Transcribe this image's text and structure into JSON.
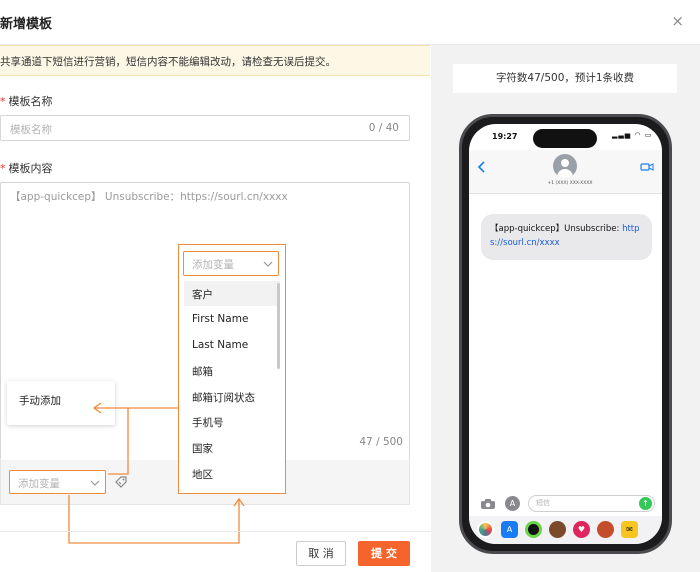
{
  "dialog": {
    "title": "新增模板",
    "close_glyph": "×",
    "notice": "共享通道下短信进行营销，短信内容不能编辑改动，请检查无误后提交。",
    "name_label": "模板名称",
    "name_placeholder": "模板名称",
    "name_counter": "0 / 40",
    "content_label": "模板内容",
    "content_text": "【app-quickcep】 Unsubscribe：https://sourl.cn/xxxx",
    "content_counter": "47 / 500",
    "variable_placeholder": "添加变量",
    "variable_dropdown_placeholder": "添加变量",
    "variable_options": [
      "客户",
      "First Name",
      "Last Name",
      "邮箱",
      "邮箱订阅状态",
      "手机号",
      "国家",
      "地区"
    ],
    "manual_add": "手动添加",
    "cancel_label": "取 消",
    "submit_label": "提 交",
    "required_mark": "*"
  },
  "preview": {
    "char_info": "字符数47/500，预计1条收费",
    "status_time": "19:27",
    "contact_number": "+1 (XXX) XXX-XXXX",
    "message_prefix": "【app-quickcep】Unsubscribe: ",
    "message_link": "https://sourl.cn/xxxx",
    "input_placeholder": "短信"
  },
  "colors": {
    "accent": "#f5642c",
    "highlight": "#f08a3c",
    "link": "#1a5bd6",
    "bubble": "#e9e9eb"
  },
  "icons": {
    "close": "close-icon",
    "dropdown": "chevron-down-icon",
    "tag": "tag-icon",
    "back": "chevron-left-icon",
    "video": "video-icon",
    "camera": "camera-icon",
    "appstore": "appstore-icon",
    "send": "send-arrow-icon"
  }
}
